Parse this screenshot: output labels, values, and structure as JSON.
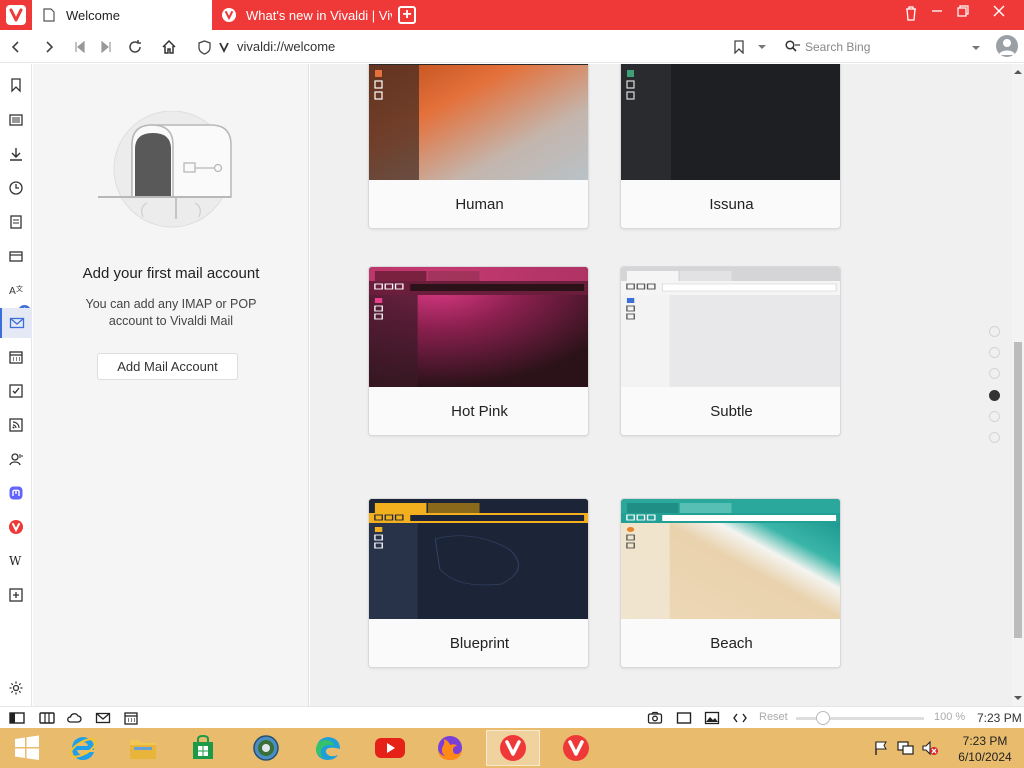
{
  "tabs": [
    {
      "title": "Welcome",
      "active": true
    },
    {
      "title": "What's new in Vivaldi | Viv",
      "active": false
    }
  ],
  "address": {
    "url": "vivaldi://welcome",
    "search_placeholder": "Search Bing"
  },
  "sidebar": {
    "mail_badge": "1",
    "items": [
      "bookmarks-icon",
      "reading-list-icon",
      "downloads-icon",
      "history-icon",
      "notes-icon",
      "mail-icon",
      "translate-icon",
      "mail-active-icon",
      "calendar-icon",
      "tasks-icon",
      "feeds-icon",
      "contacts-icon",
      "mastodon-icon",
      "vivaldi-icon",
      "wikipedia-icon",
      "add-panel-icon",
      "settings-icon"
    ]
  },
  "mail_panel": {
    "title": "Add your first mail account",
    "description": "You can add any IMAP or POP account to Vivaldi Mail",
    "button": "Add Mail Account"
  },
  "themes": [
    {
      "name": "Human",
      "accent": "#e4703a"
    },
    {
      "name": "Issuna",
      "accent": "#3ea077"
    },
    {
      "name": "Hot Pink",
      "accent": "#e83e8c"
    },
    {
      "name": "Subtle",
      "accent": "#3d6fd8"
    },
    {
      "name": "Blueprint",
      "accent": "#f2b01e"
    },
    {
      "name": "Beach",
      "accent": "#e8832f"
    }
  ],
  "pager": {
    "count": 6,
    "active": 3
  },
  "statusbar": {
    "reset_label": "Reset",
    "zoom": "100 %",
    "time": "7:23 PM"
  },
  "taskbar": {
    "time": "7:23 PM",
    "date": "6/10/2024"
  },
  "colors": {
    "brand": "#ef3939",
    "taskbar": "#e9bb6c",
    "accent": "#3d6fd8"
  }
}
